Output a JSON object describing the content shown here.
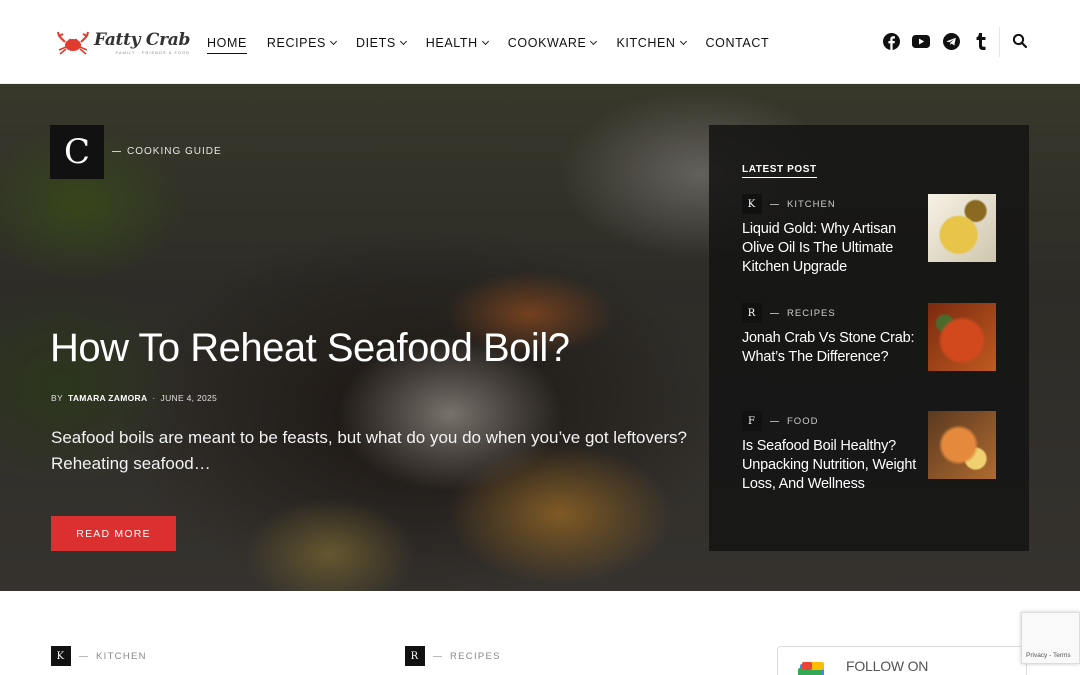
{
  "header": {
    "logo": {
      "name": "Fatty Crab",
      "tagline": "FAMILY · FRIENDS & FOOD"
    },
    "nav": [
      {
        "label": "HOME",
        "active": true,
        "has_dropdown": false
      },
      {
        "label": "RECIPES",
        "active": false,
        "has_dropdown": true
      },
      {
        "label": "DIETS",
        "active": false,
        "has_dropdown": true
      },
      {
        "label": "HEALTH",
        "active": false,
        "has_dropdown": true
      },
      {
        "label": "COOKWARE",
        "active": false,
        "has_dropdown": true
      },
      {
        "label": "KITCHEN",
        "active": false,
        "has_dropdown": true
      },
      {
        "label": "CONTACT",
        "active": false,
        "has_dropdown": false
      }
    ],
    "social_icons": [
      "facebook-icon",
      "youtube-icon",
      "telegram-icon",
      "tumblr-icon"
    ],
    "search_icon": "search-icon"
  },
  "hero": {
    "category_letter": "C",
    "category": "COOKING GUIDE",
    "title": "How To Reheat Seafood Boil?",
    "by": "BY",
    "author": "TAMARA ZAMORA",
    "separator": "·",
    "date": "JUNE 4, 2025",
    "excerpt": "Seafood boils are meant to be feasts, but what do you do when you’ve got leftovers? Reheating seafood…",
    "button": "READ MORE"
  },
  "latest": {
    "heading": "LATEST POST",
    "items": [
      {
        "letter": "K",
        "category": "KITCHEN",
        "title": "Liquid Gold: Why Artisan Olive Oil Is The Ultimate Kitchen Upgrade",
        "thumb": "olive-oil-thumbnail"
      },
      {
        "letter": "R",
        "category": "RECIPES",
        "title": "Jonah Crab Vs Stone Crab: What’s The Difference?",
        "thumb": "crab-thumbnail"
      },
      {
        "letter": "F",
        "category": "FOOD",
        "title": "Is Seafood Boil Healthy? Unpacking Nutrition, Weight Loss, And Wellness",
        "thumb": "seafood-boil-thumbnail"
      }
    ]
  },
  "bottom": {
    "categories": [
      {
        "letter": "K",
        "label": "KITCHEN"
      },
      {
        "letter": "R",
        "label": "RECIPES"
      }
    ],
    "follow": "FOLLOW ON"
  },
  "recaptcha": "Privacy - Terms",
  "colors": {
    "accent": "#dc2f2f",
    "panel": "#141414",
    "text": "#111111"
  }
}
